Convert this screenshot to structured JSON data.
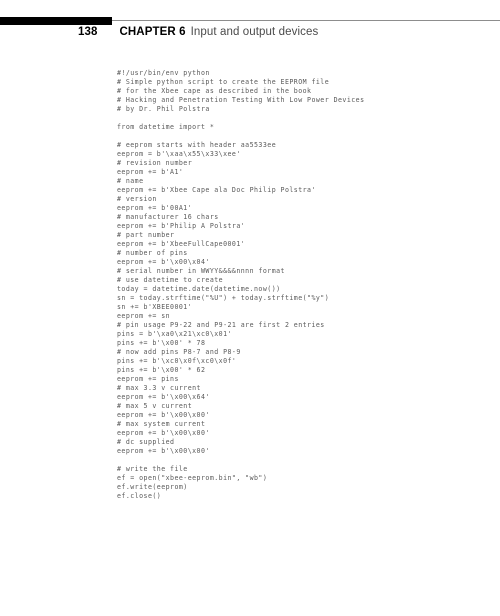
{
  "page": {
    "folio": "138",
    "chapter_label": "CHAPTER 6",
    "chapter_title": "Input and output devices"
  },
  "code_listing": {
    "language": "python",
    "lines": [
      "#!/usr/bin/env python",
      "# Simple python script to create the EEPROM file",
      "# for the Xbee cape as described in the book",
      "# Hacking and Penetration Testing With Low Power Devices",
      "# by Dr. Phil Polstra",
      "",
      "from datetime import *",
      "",
      "# eeprom starts with header aa5533ee",
      "eeprom = b'\\xaa\\x55\\x33\\xee'",
      "# revision number",
      "eeprom += b'A1'",
      "# name",
      "eeprom += b'Xbee Cape ala Doc Philip Polstra'",
      "# version",
      "eeprom += b'00A1'",
      "# manufacturer 16 chars",
      "eeprom += b'Philip A Polstra'",
      "# part number",
      "eeprom += b'XbeeFullCape0001'",
      "# number of pins",
      "eeprom += b'\\x00\\x04'",
      "# serial number in WWYY&&&&nnnn format",
      "# use datetime to create",
      "today = datetime.date(datetime.now())",
      "sn = today.strftime(\"%U\") + today.strftime(\"%y\")",
      "sn += b'XBEE0001'",
      "eeprom += sn",
      "# pin usage P9-22 and P9-21 are first 2 entries",
      "pins = b'\\xa0\\x21\\xc0\\x01'",
      "pins += b'\\x00' * 78",
      "# now add pins P8-7 and P8-9",
      "pins += b'\\xc0\\x0f\\xc0\\x0f'",
      "pins += b'\\x00' * 62",
      "eeprom += pins",
      "# max 3.3 v current",
      "eeprom += b'\\x00\\x64'",
      "# max 5 v current",
      "eeprom += b'\\x00\\x00'",
      "# max system current",
      "eeprom += b'\\x00\\x00'",
      "# dc supplied",
      "eeprom += b'\\x00\\x00'",
      "",
      "# write the file",
      "ef = open(\"xbee-eeprom.bin\", \"wb\")",
      "ef.write(eeprom)",
      "ef.close()"
    ]
  }
}
